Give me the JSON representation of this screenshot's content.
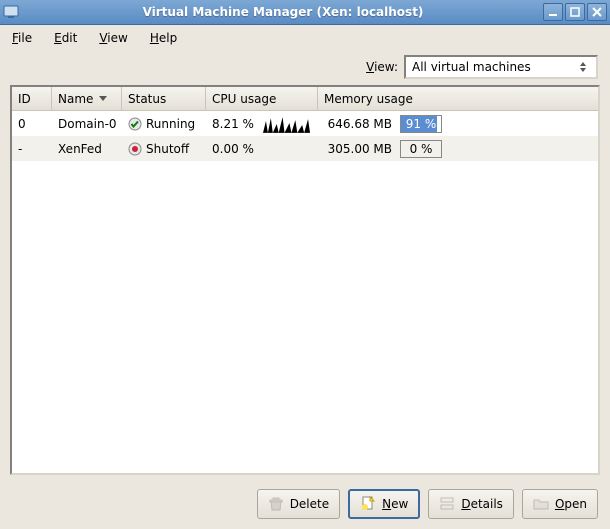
{
  "window": {
    "title": "Virtual Machine Manager (Xen: localhost)"
  },
  "menubar": {
    "file": "File",
    "edit": "Edit",
    "view": "View",
    "help": "Help"
  },
  "viewbar": {
    "label": "View:",
    "selected": "All virtual machines"
  },
  "columns": {
    "id": "ID",
    "name": "Name",
    "status": "Status",
    "cpu": "CPU usage",
    "mem": "Memory usage"
  },
  "rows": [
    {
      "id": "0",
      "name": "Domain-0",
      "status": "Running",
      "cpu": "8.21 %",
      "mem_text": "646.68 MB",
      "mem_pct": "91 %",
      "mem_fill": 91,
      "running": true
    },
    {
      "id": "-",
      "name": "XenFed",
      "status": "Shutoff",
      "cpu": "0.00 %",
      "mem_text": "305.00 MB",
      "mem_pct": "0 %",
      "mem_fill": 0,
      "running": false
    }
  ],
  "buttons": {
    "delete": "Delete",
    "new": "New",
    "details": "Details",
    "open": "Open"
  }
}
